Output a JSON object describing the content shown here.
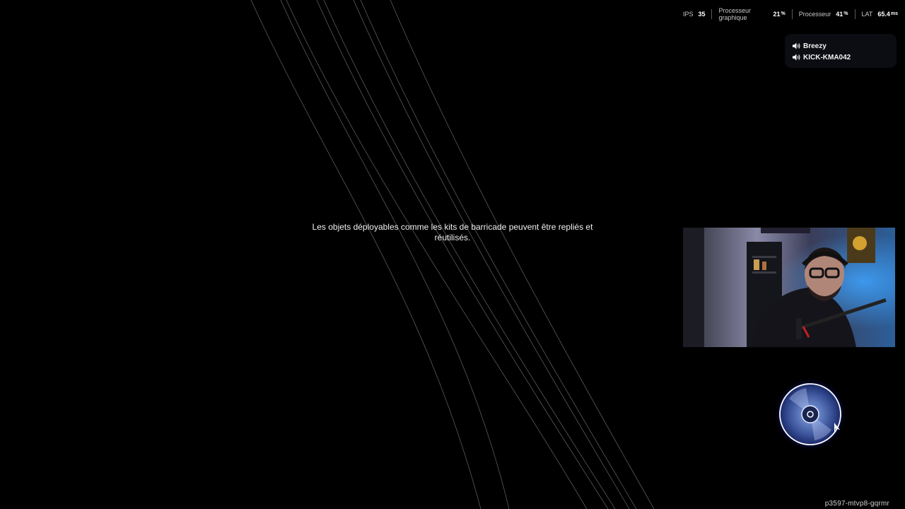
{
  "perf_stats": {
    "fps": {
      "label": "IPS",
      "value": "35"
    },
    "gpu": {
      "label_line1": "Processeur",
      "label_line2": "graphique",
      "value": "21",
      "unit": "%"
    },
    "cpu": {
      "label": "Processeur",
      "value": "41",
      "unit": "%"
    },
    "latency": {
      "label": "LAT",
      "value": "65.4",
      "unit": "ms"
    }
  },
  "voice_chat": {
    "users": [
      {
        "name": "Breezy",
        "icon": "speaker-icon"
      },
      {
        "name": "KICK-KMA042",
        "icon": "speaker-icon"
      }
    ]
  },
  "loading_tip": "Les objets déployables comme les kits de barricade peuvent être repliés et réutilisés.",
  "session_code": "p3597-mtvp8-gqrmr",
  "colors": {
    "background": "#000000",
    "spinner_glow": "#3a5cff",
    "text": "#f0f0f0"
  }
}
